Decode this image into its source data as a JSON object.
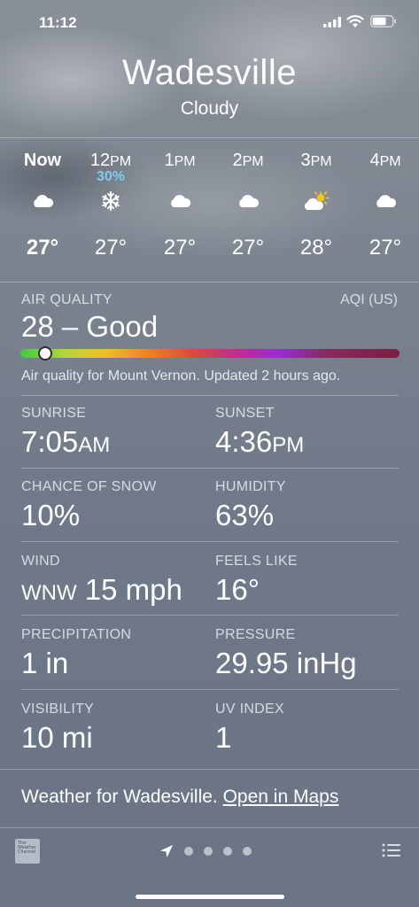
{
  "status_bar": {
    "time": "11:12"
  },
  "location": {
    "city": "Wadesville",
    "condition": "Cloudy"
  },
  "hourly": [
    {
      "label": "Now",
      "precip": "",
      "icon": "cloud-icon",
      "temp": "27°"
    },
    {
      "label": "12",
      "suffix": "PM",
      "precip": "30%",
      "icon": "snowflake-icon",
      "temp": "27°"
    },
    {
      "label": "1",
      "suffix": "PM",
      "precip": "",
      "icon": "cloud-icon",
      "temp": "27°"
    },
    {
      "label": "2",
      "suffix": "PM",
      "precip": "",
      "icon": "cloud-icon",
      "temp": "27°"
    },
    {
      "label": "3",
      "suffix": "PM",
      "precip": "",
      "icon": "partly-sunny-icon",
      "temp": "28°"
    },
    {
      "label": "4",
      "suffix": "PM",
      "precip": "",
      "icon": "cloud-icon",
      "temp": "27°"
    }
  ],
  "air_quality": {
    "title": "AIR QUALITY",
    "unit": "AQI (US)",
    "value": "28 – Good",
    "note": "Air quality for Mount Vernon. Updated 2 hours ago.",
    "aqi_fraction": 0.065
  },
  "details": {
    "sunrise": {
      "label": "SUNRISE",
      "value": "7:05",
      "suffix": "AM"
    },
    "sunset": {
      "label": "SUNSET",
      "value": "4:36",
      "suffix": "PM"
    },
    "chance_snow": {
      "label": "CHANCE OF SNOW",
      "value": "10%"
    },
    "humidity": {
      "label": "HUMIDITY",
      "value": "63%"
    },
    "wind": {
      "label": "WIND",
      "dir": "WNW",
      "value": " 15 mph"
    },
    "feels_like": {
      "label": "FEELS LIKE",
      "value": "16°"
    },
    "precipitation": {
      "label": "PRECIPITATION",
      "value": "1 in"
    },
    "pressure": {
      "label": "PRESSURE",
      "value": "29.95 inHg"
    },
    "visibility": {
      "label": "VISIBILITY",
      "value": "10 mi"
    },
    "uv_index": {
      "label": "UV INDEX",
      "value": "1"
    }
  },
  "footer": {
    "text": "Weather for Wadesville. ",
    "link": "Open in Maps"
  },
  "bottom_bar": {
    "logo_text": "The Weather Channel",
    "pages": 4
  }
}
